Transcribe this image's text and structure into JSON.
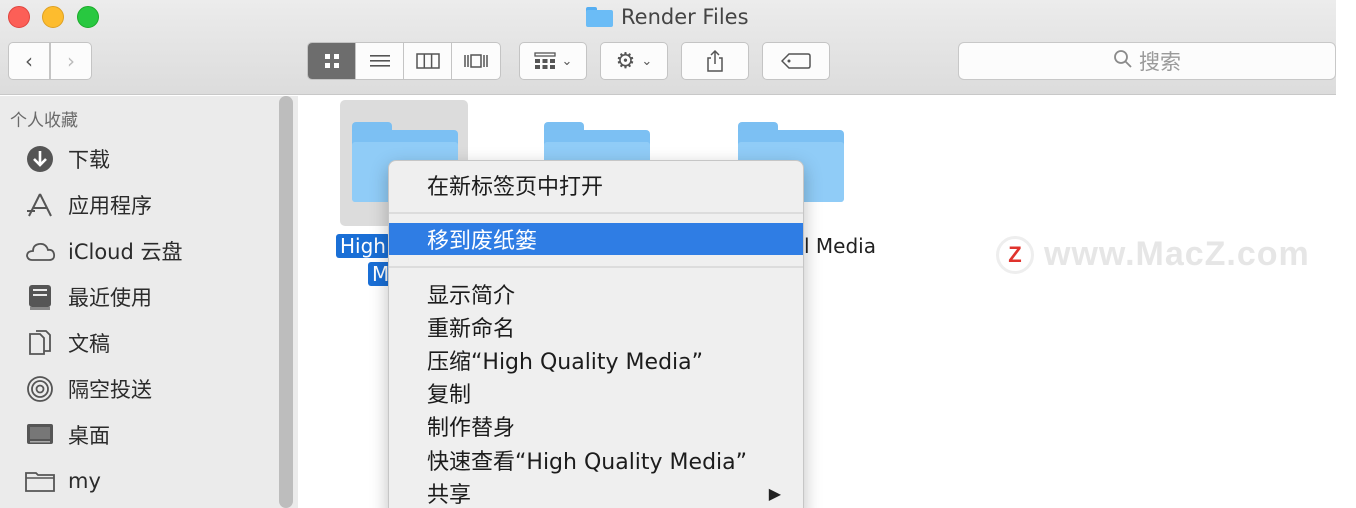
{
  "window": {
    "title": "Render Files"
  },
  "toolbar": {
    "back_icon": "chevron-left-icon",
    "forward_icon": "chevron-right-icon",
    "search_placeholder": "搜索"
  },
  "sidebar": {
    "section_title": "个人收藏",
    "items": [
      {
        "label": "下载",
        "icon": "download-icon"
      },
      {
        "label": "应用程序",
        "icon": "applications-icon"
      },
      {
        "label": "iCloud 云盘",
        "icon": "cloud-icon"
      },
      {
        "label": "最近使用",
        "icon": "recents-icon"
      },
      {
        "label": "文稿",
        "icon": "documents-icon"
      },
      {
        "label": "隔空投送",
        "icon": "airdrop-icon"
      },
      {
        "label": "桌面",
        "icon": "desktop-icon"
      },
      {
        "label": "my",
        "icon": "folder-icon"
      }
    ]
  },
  "content": {
    "selected_label_line1": "High",
    "selected_label_line2": "M",
    "third_label_partial": "l Media"
  },
  "context_menu": {
    "items": [
      "在新标签页中打开",
      "移到废纸篓",
      "显示简介",
      "重新命名",
      "压缩“High Quality Media”",
      "复制",
      "制作替身",
      "快速查看“High Quality Media”",
      "共享"
    ],
    "highlighted_index": 1
  },
  "watermark": {
    "logo": "Z",
    "text": "www.MacZ.com"
  },
  "colors": {
    "accent": "#2f7de4",
    "folder": "#7cc0f3"
  }
}
